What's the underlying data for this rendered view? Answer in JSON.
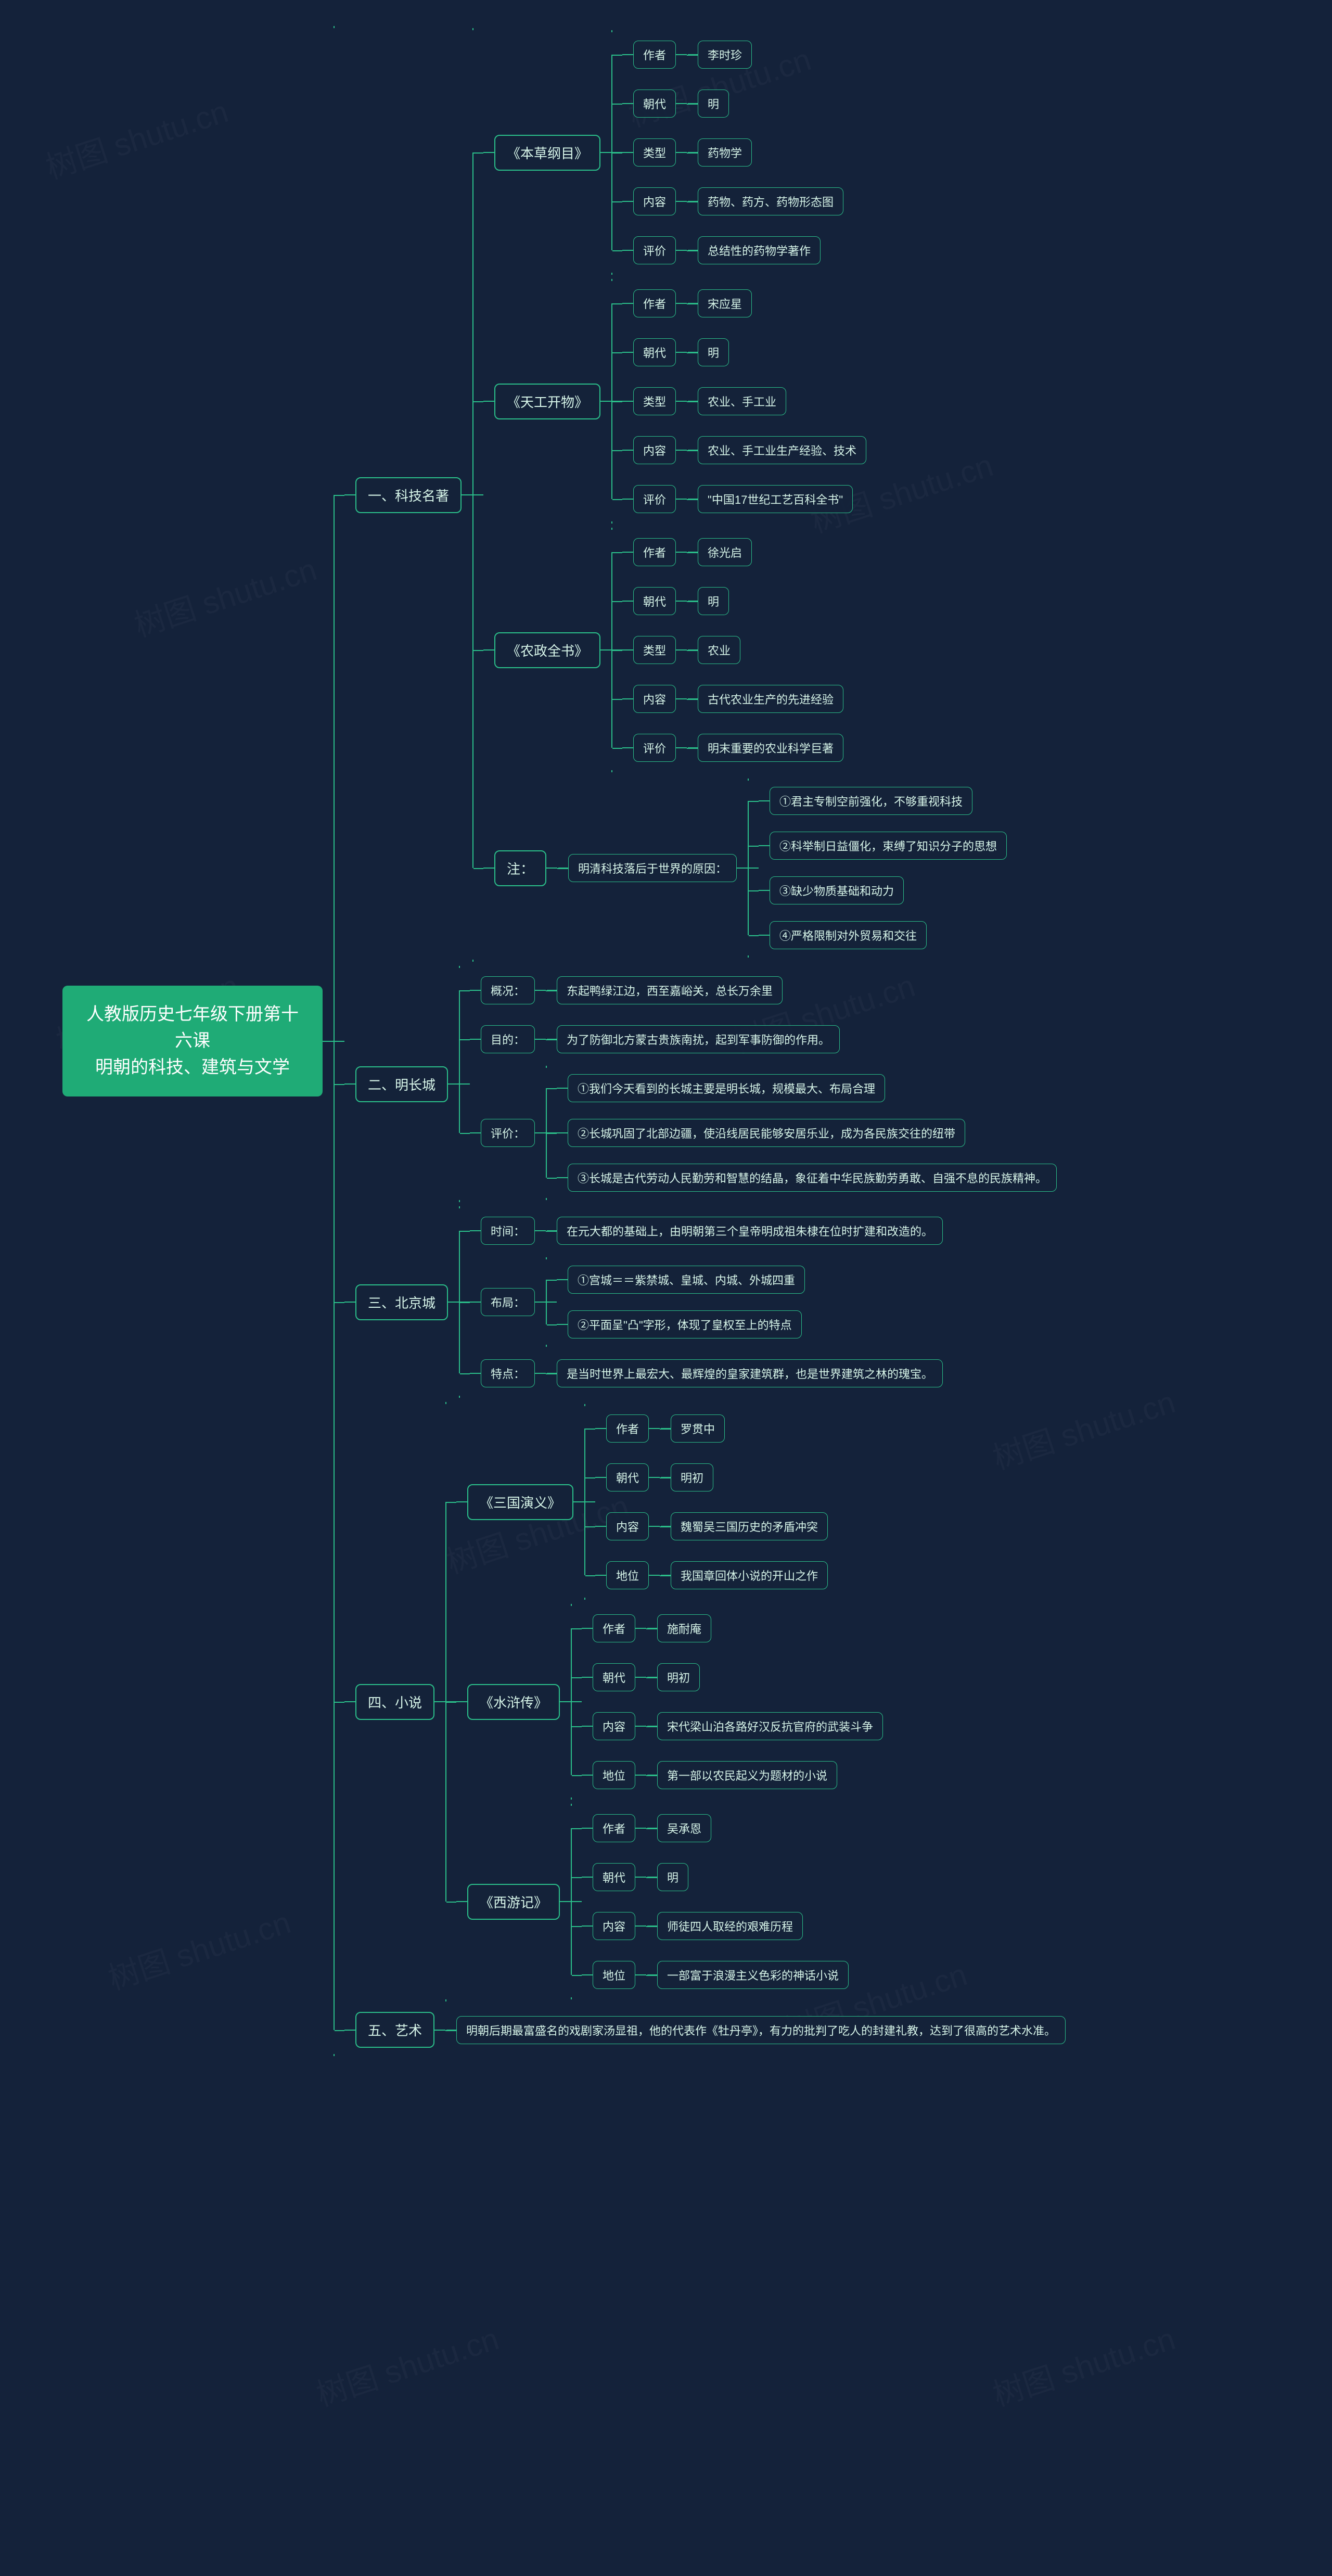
{
  "watermark": "树图 shutu.cn",
  "root": "人教版历史七年级下册第十六课\n明朝的科技、建筑与文学",
  "sections": [
    {
      "name": "s1",
      "label": "一、科技名著",
      "children": [
        {
          "name": "s1b1",
          "label": "《本草纲目》",
          "children": [
            {
              "name": "k",
              "label": "作者",
              "children": [
                {
                  "name": "v",
                  "label": "李时珍"
                }
              ]
            },
            {
              "name": "k",
              "label": "朝代",
              "children": [
                {
                  "name": "v",
                  "label": "明"
                }
              ]
            },
            {
              "name": "k",
              "label": "类型",
              "children": [
                {
                  "name": "v",
                  "label": "药物学"
                }
              ]
            },
            {
              "name": "k",
              "label": "内容",
              "children": [
                {
                  "name": "v",
                  "label": "药物、药方、药物形态图"
                }
              ]
            },
            {
              "name": "k",
              "label": "评价",
              "children": [
                {
                  "name": "v",
                  "label": "总结性的药物学著作"
                }
              ]
            }
          ]
        },
        {
          "name": "s1b2",
          "label": "《天工开物》",
          "children": [
            {
              "name": "k",
              "label": "作者",
              "children": [
                {
                  "name": "v",
                  "label": "宋应星"
                }
              ]
            },
            {
              "name": "k",
              "label": "朝代",
              "children": [
                {
                  "name": "v",
                  "label": "明"
                }
              ]
            },
            {
              "name": "k",
              "label": "类型",
              "children": [
                {
                  "name": "v",
                  "label": "农业、手工业"
                }
              ]
            },
            {
              "name": "k",
              "label": "内容",
              "children": [
                {
                  "name": "v",
                  "label": "农业、手工业生产经验、技术"
                }
              ]
            },
            {
              "name": "k",
              "label": "评价",
              "children": [
                {
                  "name": "v",
                  "label": "\"中国17世纪工艺百科全书\""
                }
              ]
            }
          ]
        },
        {
          "name": "s1b3",
          "label": "《农政全书》",
          "children": [
            {
              "name": "k",
              "label": "作者",
              "children": [
                {
                  "name": "v",
                  "label": "徐光启"
                }
              ]
            },
            {
              "name": "k",
              "label": "朝代",
              "children": [
                {
                  "name": "v",
                  "label": "明"
                }
              ]
            },
            {
              "name": "k",
              "label": "类型",
              "children": [
                {
                  "name": "v",
                  "label": "农业"
                }
              ]
            },
            {
              "name": "k",
              "label": "内容",
              "children": [
                {
                  "name": "v",
                  "label": "古代农业生产的先进经验"
                }
              ]
            },
            {
              "name": "k",
              "label": "评价",
              "children": [
                {
                  "name": "v",
                  "label": "明末重要的农业科学巨著"
                }
              ]
            }
          ]
        },
        {
          "name": "s1b4",
          "label": "注：",
          "children": [
            {
              "name": "s1b4a",
              "label": "明清科技落后于世界的原因：",
              "children": [
                {
                  "name": "r1",
                  "label": "①君主专制空前强化，不够重视科技"
                },
                {
                  "name": "r2",
                  "label": "②科举制日益僵化，束缚了知识分子的思想"
                },
                {
                  "name": "r3",
                  "label": "③缺少物质基础和动力"
                },
                {
                  "name": "r4",
                  "label": "④严格限制对外贸易和交往"
                }
              ]
            }
          ]
        }
      ]
    },
    {
      "name": "s2",
      "label": "二、明长城",
      "children": [
        {
          "name": "s2a",
          "label": "概况：",
          "children": [
            {
              "name": "v",
              "label": "东起鸭绿江边，西至嘉峪关，总长万余里"
            }
          ]
        },
        {
          "name": "s2b",
          "label": "目的：",
          "children": [
            {
              "name": "v",
              "label": "为了防御北方蒙古贵族南扰，起到军事防御的作用。"
            }
          ]
        },
        {
          "name": "s2c",
          "label": "评价：",
          "children": [
            {
              "name": "v1",
              "label": "①我们今天看到的长城主要是明长城，规模最大、布局合理"
            },
            {
              "name": "v2",
              "label": "②长城巩固了北部边疆，使沿线居民能够安居乐业，成为各民族交往的纽带"
            },
            {
              "name": "v3",
              "label": "③长城是古代劳动人民勤劳和智慧的结晶，象征着中华民族勤劳勇敢、自强不息的民族精神。"
            }
          ]
        }
      ]
    },
    {
      "name": "s3",
      "label": "三、北京城",
      "children": [
        {
          "name": "s3a",
          "label": "时间：",
          "children": [
            {
              "name": "v",
              "label": "在元大都的基础上，由明朝第三个皇帝明成祖朱棣在位时扩建和改造的。"
            }
          ]
        },
        {
          "name": "s3b",
          "label": "布局：",
          "children": [
            {
              "name": "v1",
              "label": "①宫城＝＝紫禁城、皇城、内城、外城四重"
            },
            {
              "name": "v2",
              "label": "②平面呈\"凸\"字形，体现了皇权至上的特点"
            }
          ]
        },
        {
          "name": "s3c",
          "label": "特点：",
          "children": [
            {
              "name": "v",
              "label": "是当时世界上最宏大、最辉煌的皇家建筑群，也是世界建筑之林的瑰宝。"
            }
          ]
        }
      ]
    },
    {
      "name": "s4",
      "label": "四、小说",
      "children": [
        {
          "name": "s4a",
          "label": "《三国演义》",
          "children": [
            {
              "name": "k",
              "label": "作者",
              "children": [
                {
                  "name": "v",
                  "label": "罗贯中"
                }
              ]
            },
            {
              "name": "k",
              "label": "朝代",
              "children": [
                {
                  "name": "v",
                  "label": "明初"
                }
              ]
            },
            {
              "name": "k",
              "label": "内容",
              "children": [
                {
                  "name": "v",
                  "label": "魏蜀吴三国历史的矛盾冲突"
                }
              ]
            },
            {
              "name": "k",
              "label": "地位",
              "children": [
                {
                  "name": "v",
                  "label": "我国章回体小说的开山之作"
                }
              ]
            }
          ]
        },
        {
          "name": "s4b",
          "label": "《水浒传》",
          "children": [
            {
              "name": "k",
              "label": "作者",
              "children": [
                {
                  "name": "v",
                  "label": "施耐庵"
                }
              ]
            },
            {
              "name": "k",
              "label": "朝代",
              "children": [
                {
                  "name": "v",
                  "label": "明初"
                }
              ]
            },
            {
              "name": "k",
              "label": "内容",
              "children": [
                {
                  "name": "v",
                  "label": "宋代梁山泊各路好汉反抗官府的武装斗争"
                }
              ]
            },
            {
              "name": "k",
              "label": "地位",
              "children": [
                {
                  "name": "v",
                  "label": "第一部以农民起义为题材的小说"
                }
              ]
            }
          ]
        },
        {
          "name": "s4c",
          "label": "《西游记》",
          "children": [
            {
              "name": "k",
              "label": "作者",
              "children": [
                {
                  "name": "v",
                  "label": "吴承恩"
                }
              ]
            },
            {
              "name": "k",
              "label": "朝代",
              "children": [
                {
                  "name": "v",
                  "label": "明"
                }
              ]
            },
            {
              "name": "k",
              "label": "内容",
              "children": [
                {
                  "name": "v",
                  "label": "师徒四人取经的艰难历程"
                }
              ]
            },
            {
              "name": "k",
              "label": "地位",
              "children": [
                {
                  "name": "v",
                  "label": "一部富于浪漫主义色彩的神话小说"
                }
              ]
            }
          ]
        }
      ]
    },
    {
      "name": "s5",
      "label": "五、艺术",
      "children": [
        {
          "name": "s5a",
          "label": "明朝后期最富盛名的戏剧家汤显祖，他的代表作《牡丹亭》，有力的批判了吃人的封建礼教，达到了很高的艺术水准。"
        }
      ]
    }
  ]
}
